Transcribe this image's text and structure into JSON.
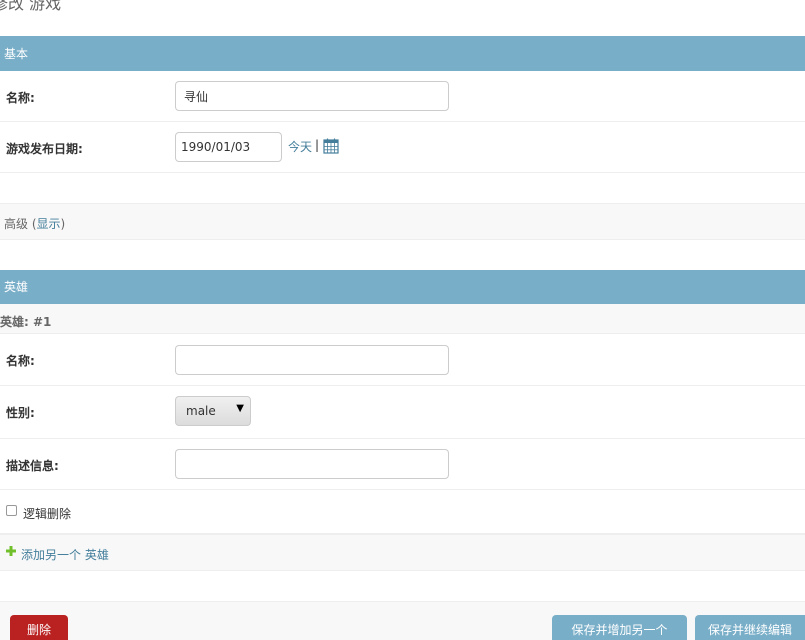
{
  "page": {
    "title": "修改 游戏"
  },
  "basic": {
    "header": "基本",
    "name_label": "名称:",
    "name_value": "寻仙",
    "date_label": "游戏发布日期:",
    "date_value": "1990/01/03",
    "today_link": "今天",
    "separator": "|"
  },
  "advanced": {
    "label": "高级 (",
    "show_link": "显示",
    "close_paren": ")"
  },
  "hero": {
    "header": "英雄",
    "inline_title": "英雄: #1",
    "name_label": "名称:",
    "name_value": "",
    "gender_label": "性别:",
    "gender_value": "male",
    "desc_label": "描述信息:",
    "desc_value": "",
    "delete_checkbox_label": "逻辑删除",
    "add_another_link": "添加另一个 英雄"
  },
  "actions": {
    "delete_button": "删除",
    "save_add_another": "保存并增加另一个",
    "save_continue": "保存并继续编辑"
  },
  "colors": {
    "module_header_bg": "#79aec8",
    "link": "#447e9b",
    "delete_button": "#ba2121",
    "save_button": "#79aec8",
    "add_icon": "#70bf2b"
  }
}
